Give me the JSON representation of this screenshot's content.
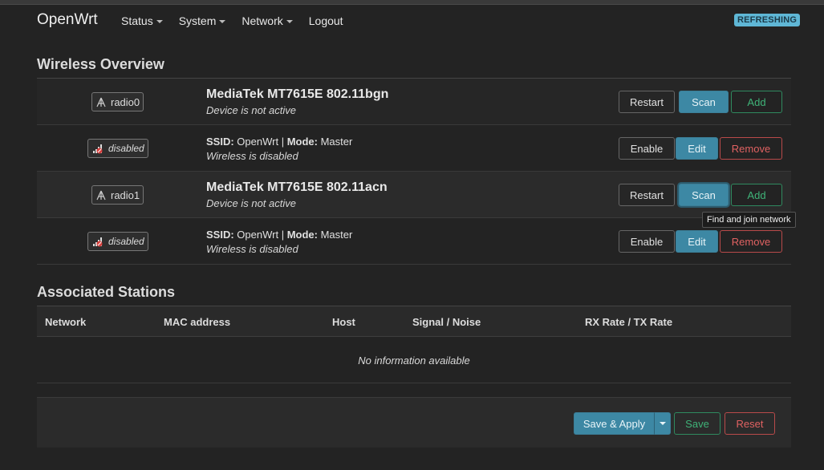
{
  "brand": "OpenWrt",
  "nav": [
    {
      "label": "Status",
      "dropdown": true
    },
    {
      "label": "System",
      "dropdown": true
    },
    {
      "label": "Network",
      "dropdown": true
    },
    {
      "label": "Logout",
      "dropdown": false
    }
  ],
  "status_badge": "REFRESHING",
  "wireless": {
    "title": "Wireless Overview",
    "rows": [
      {
        "kind": "device",
        "badge": "radio0",
        "title": "MediaTek MT7615E 802.11bgn",
        "sub": "Device is not active",
        "buttons": [
          "Restart",
          "Scan",
          "Add"
        ]
      },
      {
        "kind": "network",
        "badge": "disabled",
        "ssid_label": "SSID:",
        "ssid": "OpenWrt",
        "mode_label": "Mode:",
        "mode": "Master",
        "sub": "Wireless is disabled",
        "buttons": [
          "Enable",
          "Edit",
          "Remove"
        ]
      },
      {
        "kind": "device",
        "badge": "radio1",
        "title": "MediaTek MT7615E 802.11acn",
        "sub": "Device is not active",
        "buttons": [
          "Restart",
          "Scan",
          "Add"
        ]
      },
      {
        "kind": "network",
        "badge": "disabled",
        "ssid_label": "SSID:",
        "ssid": "OpenWrt",
        "mode_label": "Mode:",
        "mode": "Master",
        "sub": "Wireless is disabled",
        "buttons": [
          "Enable",
          "Edit",
          "Remove"
        ]
      }
    ]
  },
  "tooltip": "Find and join network",
  "stations": {
    "title": "Associated Stations",
    "columns": [
      "Network",
      "MAC address",
      "Host",
      "Signal / Noise",
      "RX Rate / TX Rate"
    ],
    "empty_text": "No information available"
  },
  "footer": {
    "save_apply": "Save & Apply",
    "save": "Save",
    "reset": "Reset"
  },
  "colors": {
    "background": "#232323",
    "accent_blue": "#3d88a4",
    "green": "#3fb378",
    "red": "#e06262",
    "badge_refresh": "#5fb7d6"
  }
}
